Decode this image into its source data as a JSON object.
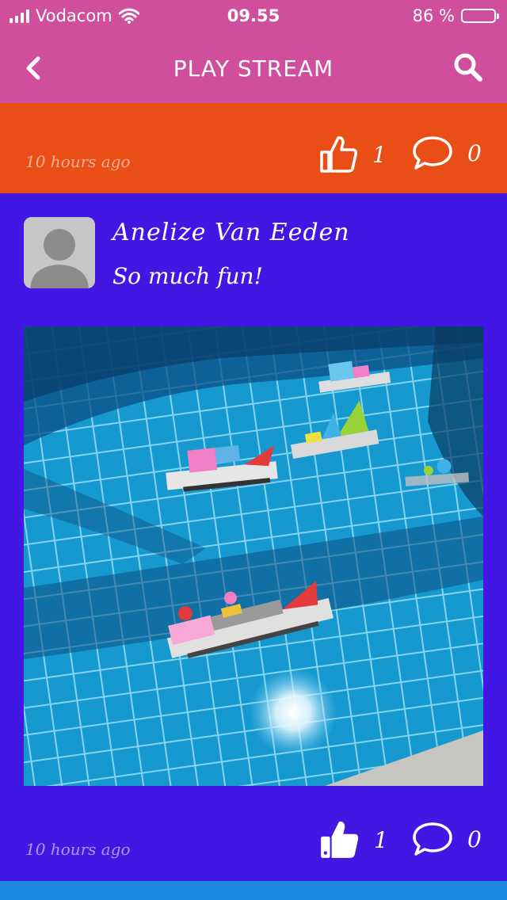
{
  "status": {
    "carrier": "Vodacom",
    "time": "09.55",
    "battery_text": "86 %",
    "battery_level": 0.86
  },
  "nav": {
    "title": "PLAY STREAM",
    "back_icon": "chevron-left-icon",
    "search_icon": "search-icon"
  },
  "posts": [
    {
      "timestamp": "10 hours ago",
      "likes": "1",
      "comments": "0",
      "color": "#e84e15"
    },
    {
      "author": "Anelize Van Eeden",
      "message": "So much fun!",
      "timestamp": "10 hours ago",
      "likes": "1",
      "comments": "0",
      "color": "#4217e4"
    }
  ],
  "colors": {
    "header": "#d04f9c",
    "next_card": "#1d8ae0"
  }
}
